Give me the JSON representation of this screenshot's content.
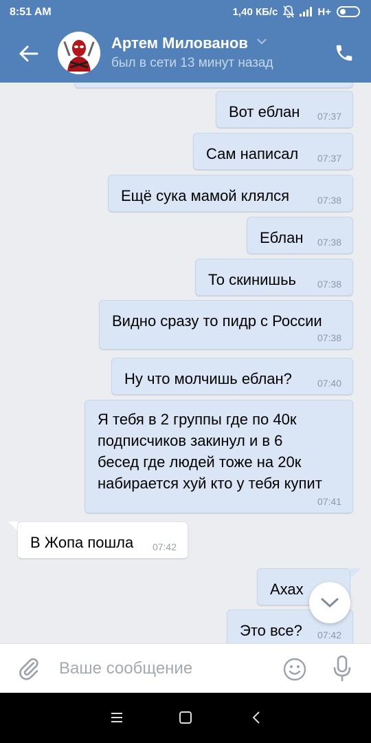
{
  "status_bar": {
    "time": "8:51 AM",
    "speed": "1,40 КБ/с",
    "network": "H+"
  },
  "header": {
    "name": "Артем Милованов",
    "status": "был в сети 13 минут назад",
    "bg_color": "#5181b8"
  },
  "messages": [
    {
      "dir": "out",
      "text": "Вот еблан",
      "time": "07:37"
    },
    {
      "dir": "out",
      "text": "Сам написал",
      "time": "07:37"
    },
    {
      "dir": "out",
      "text": "Ещё сука мамой клялся",
      "time": "07:38"
    },
    {
      "dir": "out",
      "text": "Еблан",
      "time": "07:38"
    },
    {
      "dir": "out",
      "text": "То скинишьь",
      "time": "07:38"
    },
    {
      "dir": "out",
      "text": "Видно сразу то пидр с России",
      "time": "07:38"
    },
    {
      "dir": "out",
      "text": "Ну что молчишь еблан?",
      "time": "07:40"
    },
    {
      "dir": "out",
      "lines": [
        "Я тебя в 2 группы где по 40к",
        "подписчиков закинул и в 6",
        "бесед где людей тоже на 20к",
        "набирается хуй кто у тебя купит"
      ],
      "time": "07:41"
    },
    {
      "dir": "in",
      "text": "В Жопа пошла",
      "time": "07:42"
    },
    {
      "dir": "out",
      "text": "Ахах",
      "time": ""
    },
    {
      "dir": "out",
      "text": "Это все?",
      "time": "07:42"
    }
  ],
  "composer": {
    "placeholder": "Ваше сообщение"
  },
  "icons": {
    "back": "arrow-left-icon",
    "call": "phone-icon",
    "attach": "paperclip-icon",
    "emoji": "smiley-icon",
    "mic": "microphone-icon",
    "scroll": "chevron-down-icon"
  },
  "colors": {
    "outgoing_bubble": "#dae6f5",
    "incoming_bubble": "#ffffff",
    "chat_bg": "#ebedf0"
  }
}
